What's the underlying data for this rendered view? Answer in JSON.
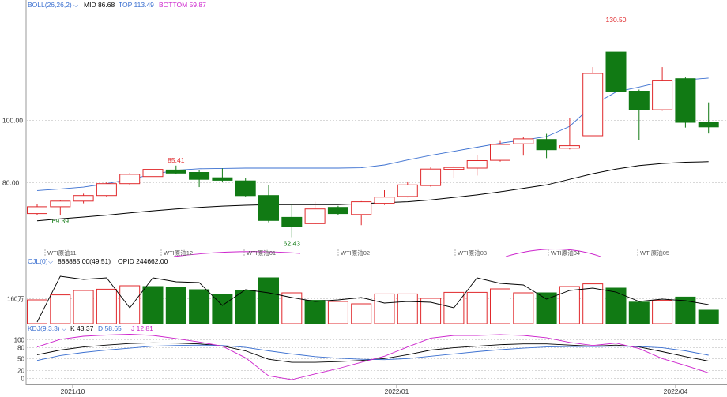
{
  "colors": {
    "up": "#e0292c",
    "down": "#117a14",
    "boll_mid": "#000000",
    "boll_top": "#3a6fd0",
    "boll_bottom": "#cc22cc",
    "kdj_k": "#000000",
    "kdj_d": "#3a6fd0",
    "kdj_j": "#cc22cc",
    "grid": "#cccccc",
    "axis": "#9a9a9a"
  },
  "legends": {
    "boll": {
      "name": "BOLL(26,26,2)",
      "mid": "MID 86.68",
      "top": "TOP 113.49",
      "bottom": "BOTTOM 59.87"
    },
    "cjl": {
      "name": "CJL(0)",
      "volume": "888885.00(49:51)",
      "opid": "OPID 244662.00"
    },
    "kdj": {
      "name": "KDJ(9,3,3)",
      "k": "K 43.37",
      "d": "D 58.65",
      "j": "J 12.81"
    }
  },
  "chart_data": [
    {
      "type": "candlestick",
      "panel": "price",
      "indicator": "BOLL(26,26,2)",
      "y_ticks": [
        "100.00",
        "80.00"
      ],
      "y_tick_values": [
        100,
        80
      ],
      "ylim": [
        58,
        135
      ],
      "grid": true,
      "candles": [
        {
          "o": 70.0,
          "c": 72.2,
          "h": 73.2,
          "l": 69.6
        },
        {
          "o": 72.2,
          "c": 74.0,
          "h": 74.4,
          "l": 69.39
        },
        {
          "o": 74.0,
          "c": 75.8,
          "h": 76.4,
          "l": 73.3
        },
        {
          "o": 75.8,
          "c": 79.6,
          "h": 80.2,
          "l": 75.4
        },
        {
          "o": 79.6,
          "c": 82.6,
          "h": 83.0,
          "l": 79.2
        },
        {
          "o": 81.9,
          "c": 84.2,
          "h": 84.8,
          "l": 81.6
        },
        {
          "o": 84.0,
          "c": 83.0,
          "h": 85.41,
          "l": 82.7
        },
        {
          "o": 83.2,
          "c": 81.0,
          "h": 84.0,
          "l": 78.5
        },
        {
          "o": 81.5,
          "c": 80.7,
          "h": 84.5,
          "l": 80.3
        },
        {
          "o": 80.5,
          "c": 75.8,
          "h": 81.3,
          "l": 75.5
        },
        {
          "o": 75.8,
          "c": 67.8,
          "h": 79.2,
          "l": 67.2
        },
        {
          "o": 68.8,
          "c": 65.8,
          "h": 73.2,
          "l": 62.43
        },
        {
          "o": 66.8,
          "c": 71.5,
          "h": 73.8,
          "l": 66.6
        },
        {
          "o": 72.0,
          "c": 70.0,
          "h": 72.5,
          "l": 69.6
        },
        {
          "o": 69.7,
          "c": 73.8,
          "h": 74.0,
          "l": 66.3
        },
        {
          "o": 73.3,
          "c": 75.3,
          "h": 77.5,
          "l": 72.8
        },
        {
          "o": 75.5,
          "c": 79.2,
          "h": 80.3,
          "l": 75.2
        },
        {
          "o": 79.0,
          "c": 84.3,
          "h": 85.0,
          "l": 78.6
        },
        {
          "o": 84.2,
          "c": 84.8,
          "h": 85.2,
          "l": 81.5
        },
        {
          "o": 84.6,
          "c": 87.0,
          "h": 88.7,
          "l": 82.2
        },
        {
          "o": 87.1,
          "c": 92.2,
          "h": 93.3,
          "l": 86.7
        },
        {
          "o": 92.4,
          "c": 94.0,
          "h": 94.5,
          "l": 88.6
        },
        {
          "o": 93.8,
          "c": 90.5,
          "h": 95.6,
          "l": 87.8
        },
        {
          "o": 91.0,
          "c": 91.8,
          "h": 100.8,
          "l": 90.6
        },
        {
          "o": 95.0,
          "c": 115.0,
          "h": 117.0,
          "l": 94.9
        },
        {
          "o": 121.8,
          "c": 109.3,
          "h": 130.5,
          "l": 109.0
        },
        {
          "o": 109.3,
          "c": 103.3,
          "h": 109.8,
          "l": 93.7
        },
        {
          "o": 103.3,
          "c": 112.8,
          "h": 117.0,
          "l": 103.0
        },
        {
          "o": 113.3,
          "c": 99.3,
          "h": 113.7,
          "l": 97.6
        },
        {
          "o": 99.3,
          "c": 97.8,
          "h": 105.7,
          "l": 95.7
        }
      ],
      "boll_mid": [
        67.7,
        68.3,
        68.9,
        69.5,
        70.2,
        70.9,
        71.5,
        72.0,
        72.4,
        72.7,
        72.9,
        72.9,
        72.9,
        72.9,
        73.2,
        73.5,
        73.8,
        74.4,
        75.2,
        76.0,
        77.0,
        78.1,
        79.2,
        81.0,
        82.8,
        84.3,
        85.4,
        86.1,
        86.5,
        86.68
      ],
      "boll_top": [
        77.4,
        77.9,
        78.5,
        79.6,
        81.0,
        82.6,
        83.9,
        84.4,
        84.5,
        84.6,
        84.6,
        84.6,
        84.6,
        84.6,
        84.7,
        85.6,
        87.2,
        88.7,
        90.0,
        91.3,
        92.6,
        93.6,
        94.7,
        98.0,
        104.8,
        109.0,
        110.6,
        112.3,
        112.9,
        113.49
      ],
      "boll_bottom": [
        59.87
      ],
      "annotations": [
        "130.50",
        "85.41",
        "69.39",
        "62.43"
      ],
      "period_labels": [
        "WTI原油11",
        "WTI原油12",
        "WTI原油01",
        "WTI原油02",
        "WTI原油03",
        "WTI原油04",
        "WTI原油05"
      ]
    },
    {
      "type": "bar",
      "panel": "volume",
      "indicator": "CJL(0)",
      "y_ticks": [
        "160万"
      ],
      "y_tick_values": [
        160
      ],
      "ylim": [
        0,
        350
      ],
      "values": [
        150,
        182,
        210,
        218,
        240,
        235,
        232,
        215,
        187,
        210,
        290,
        195,
        147,
        140,
        125,
        188,
        188,
        160,
        198,
        198,
        220,
        195,
        195,
        235,
        252,
        225,
        136,
        147,
        168,
        85
      ],
      "up_down": [
        "up",
        "up",
        "up",
        "up",
        "up",
        "down",
        "down",
        "down",
        "down",
        "down",
        "down",
        "up",
        "down",
        "up",
        "up",
        "up",
        "up",
        "up",
        "up",
        "up",
        "up",
        "up",
        "down",
        "up",
        "up",
        "down",
        "down",
        "up",
        "down",
        "down"
      ],
      "opid_line": [
        10,
        300,
        280,
        290,
        100,
        290,
        265,
        260,
        115,
        215,
        195,
        165,
        140,
        150,
        165,
        130,
        140,
        135,
        100,
        290,
        255,
        245,
        155,
        210,
        225,
        200,
        140,
        155,
        145,
        120
      ]
    },
    {
      "type": "line",
      "panel": "kdj",
      "indicator": "KDJ(9,3,3)",
      "y_ticks": [
        "100",
        "80",
        "50",
        "20",
        "0"
      ],
      "y_tick_values": [
        100,
        80,
        50,
        20,
        0
      ],
      "ylim": [
        -15,
        112
      ],
      "series": [
        {
          "name": "K",
          "values": [
            60,
            72,
            80,
            85,
            89,
            91,
            90,
            88,
            83,
            70,
            48,
            40,
            40,
            42,
            45,
            50,
            60,
            72,
            78,
            82,
            86,
            88,
            88,
            85,
            82,
            85,
            80,
            68,
            55,
            43.37
          ]
        },
        {
          "name": "D",
          "values": [
            45,
            58,
            66,
            72,
            77,
            82,
            84,
            85,
            84,
            79,
            70,
            62,
            55,
            51,
            48,
            47,
            50,
            56,
            62,
            68,
            73,
            77,
            80,
            81,
            81,
            82,
            81,
            78,
            70,
            58.65
          ]
        },
        {
          "name": "J",
          "values": [
            80,
            100,
            108,
            111,
            113,
            110,
            102,
            93,
            82,
            52,
            5,
            -5,
            10,
            24,
            40,
            56,
            80,
            103,
            110,
            110,
            112,
            110,
            104,
            92,
            84,
            90,
            76,
            50,
            32,
            12.81
          ]
        }
      ]
    }
  ],
  "x_axis": {
    "ticks": [
      "2021/10",
      "2022/01",
      "2022/04"
    ]
  }
}
